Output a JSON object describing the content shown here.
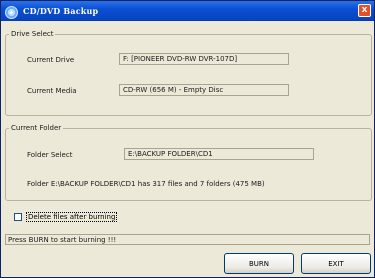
{
  "window": {
    "title": "CD/DVD Backup",
    "close_glyph": "x"
  },
  "drive_select": {
    "legend": "Drive Select",
    "current_drive_label": "Current Drive",
    "current_drive_value": "F: [PIONEER  DVD-RW  DVR-107D]",
    "current_media_label": "Current Media",
    "current_media_value": "CD-RW (656 M) -  Empty Disc"
  },
  "current_folder": {
    "legend": "Current Folder",
    "folder_select_label": "Folder Select",
    "folder_select_value": "E:\\BACKUP FOLDER\\CD1",
    "summary": "Folder E:\\BACKUP FOLDER\\CD1 has 317 files and 7 folders (475 MB)"
  },
  "options": {
    "delete_after_burning_label": "Delete files after burning",
    "delete_after_burning_checked": false
  },
  "status": {
    "message": "Press BURN to start burning !!!"
  },
  "buttons": {
    "burn": "BURN",
    "exit": "EXIT"
  },
  "colors": {
    "titlebar": "#0a4fd4",
    "window_bg": "#ece9d8",
    "close_button": "#e0502a"
  }
}
